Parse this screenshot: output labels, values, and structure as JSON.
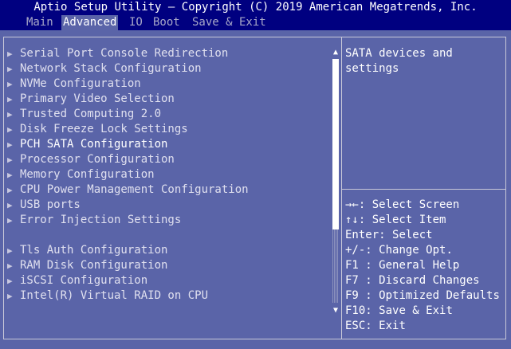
{
  "title": "Aptio Setup Utility – Copyright (C) 2019 American Megatrends, Inc.",
  "menu": {
    "tabs": [
      {
        "label": "Main"
      },
      {
        "label": "Advanced"
      },
      {
        "label": "IO"
      },
      {
        "label": "Boot"
      },
      {
        "label": "Save & Exit"
      }
    ],
    "active": "Advanced"
  },
  "items": [
    {
      "label": "Serial Port Console Redirection"
    },
    {
      "label": "Network Stack Configuration"
    },
    {
      "label": "NVMe Configuration"
    },
    {
      "label": "Primary Video Selection"
    },
    {
      "label": "Trusted Computing 2.0"
    },
    {
      "label": "Disk Freeze Lock Settings"
    },
    {
      "label": "PCH SATA Configuration"
    },
    {
      "label": "Processor Configuration"
    },
    {
      "label": "Memory Configuration"
    },
    {
      "label": "CPU Power Management Configuration"
    },
    {
      "label": "USB ports"
    },
    {
      "label": "Error Injection Settings"
    },
    {
      "label": "Tls Auth Configuration"
    },
    {
      "label": "RAM Disk Configuration"
    },
    {
      "label": "iSCSI Configuration"
    },
    {
      "label": "Intel(R) Virtual RAID on CPU"
    }
  ],
  "selected_item": "PCH SATA Configuration",
  "submenu_arrow": "▶",
  "help_text": "SATA devices and\nsettings",
  "scroll": {
    "up_arrow": "▲",
    "down_arrow": "▼",
    "thumb_fraction": 0.7
  },
  "keys": [
    {
      "key": "→←",
      "action": ": Select Screen"
    },
    {
      "key": "↑↓",
      "action": ": Select Item"
    },
    {
      "key": "Enter",
      "action": ": Select"
    },
    {
      "key": "+/-",
      "action": ": Change Opt."
    },
    {
      "key": "F1 ",
      "action": ": General Help"
    },
    {
      "key": "F7 ",
      "action": ": Discard Changes"
    },
    {
      "key": "F9 ",
      "action": ": Optimized Defaults"
    },
    {
      "key": "F10",
      "action": ": Save & Exit"
    },
    {
      "key": "ESC",
      "action": ": Exit"
    }
  ],
  "colors": {
    "background": "#5a64a8",
    "header": "#000080",
    "text": "#ffffff"
  }
}
